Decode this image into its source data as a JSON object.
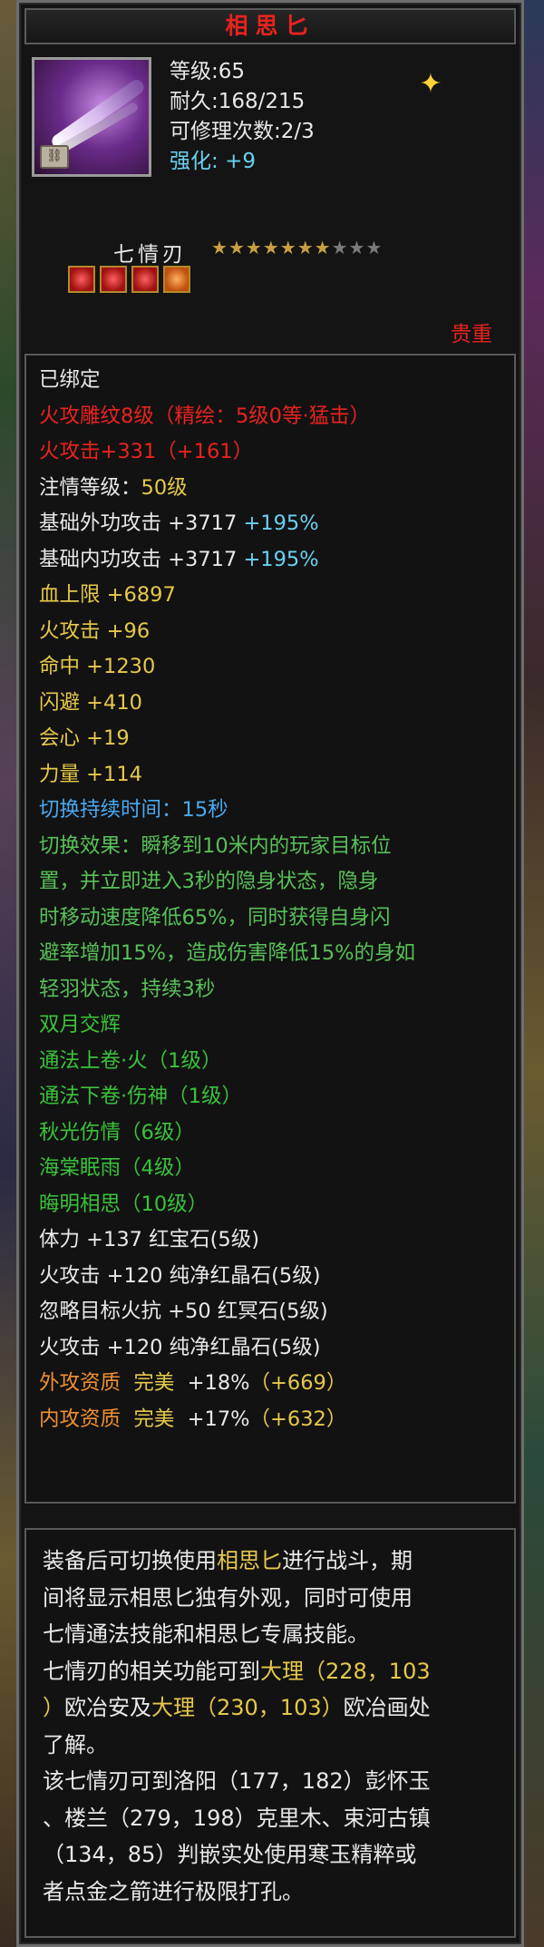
{
  "item": {
    "name": "相思匕",
    "level": "等级:65",
    "durability": "耐久:168/215",
    "repairs": "可修理次数:2/3",
    "enhance_label": "强化:",
    "enhance_value": "+9",
    "sub_name": "七情刃",
    "stars": {
      "filled": 7,
      "total": 10
    },
    "gem_count": 4,
    "rarity": "贵重"
  },
  "colors": {
    "title": "#e8231e",
    "white": "#e8e8e8",
    "red": "#e8231e",
    "yellow": "#e6c84a",
    "cyan": "#6ad0f0",
    "blue": "#4aa8f0",
    "green": "#3ac23a",
    "orange": "#f09030",
    "border": "#6e6e6e"
  },
  "icons": {
    "weapon": "dagger-icon",
    "bound": "lock-icon",
    "special": "sparkle-icon",
    "star": "star-icon",
    "gem": "gem-slot-icon"
  },
  "attributes": {
    "bound": "已绑定",
    "fire_engrave": "火攻雕纹8级（精绘：5级0等·猛击）",
    "fire_attack_engrave": "火攻击+331（+161）",
    "infuse_level_label": "注情等级：",
    "infuse_level_value": "50级",
    "base_ext_label": "基础外功攻击",
    "base_ext_value": "+3717",
    "base_ext_pct": "+195%",
    "base_int_label": "基础内功攻击",
    "base_int_value": "+3717",
    "base_int_pct": "+195%",
    "hp": "血上限 +6897",
    "fire": "火攻击 +96",
    "hit": "命中 +1230",
    "dodge": "闪避 +410",
    "crit": "会心 +19",
    "str": "力量 +114",
    "switch_duration": "切换持续时间：15秒",
    "switch_effect": [
      "切换效果：瞬移到10米内的玩家目标位",
      "置，并立即进入3秒的隐身状态，隐身",
      "时移动速度降低65%，同时获得自身闪",
      "避率增加15%，造成伤害降低15%的身如",
      "轻羽状态，持续3秒"
    ],
    "skills": [
      "双月交辉",
      "通法上卷·火（1级）",
      "通法下卷·伤神（1级）",
      "秋光伤情（6级）",
      "海棠眠雨（4级）",
      "晦明相思（10级）"
    ],
    "gem_stats": [
      "体力 +137 红宝石(5级)",
      "火攻击 +120 纯净红晶石(5级)",
      "忽略目标火抗 +50 红冥石(5级)",
      "火攻击 +120 纯净红晶石(5级)"
    ],
    "aptitude": [
      {
        "label": "外攻资质",
        "grade": "完美",
        "pct": "+18%",
        "extra": "（+669）"
      },
      {
        "label": "内攻资质",
        "grade": "完美",
        "pct": "+17%",
        "extra": "（+632）"
      }
    ]
  },
  "description": {
    "l1a": "装备后可切换使用",
    "l1b": "相思匕",
    "l1c": "进行战斗，期",
    "l2a": "间将显示相思匕独有外观，同时可使用",
    "l3a": "七情通法技能和相思匕专属技能。",
    "l4a": "七情刃的相关功能可到",
    "l4b": "大理（228，103",
    "l5a": "）",
    "l5b": "欧冶安",
    "l5c": "及",
    "l5d": "大理（230，103）",
    "l5e": "欧冶画",
    "l5f": "处",
    "l6a": "了解。",
    "l7": "该七情刃可到洛阳（177，182）彭怀玉",
    "l8": "、楼兰（279，198）克里木、束河古镇",
    "l9": "（134，85）判嵌实处使用寒玉精粹或",
    "l10": "者点金之箭进行极限打孔。"
  }
}
